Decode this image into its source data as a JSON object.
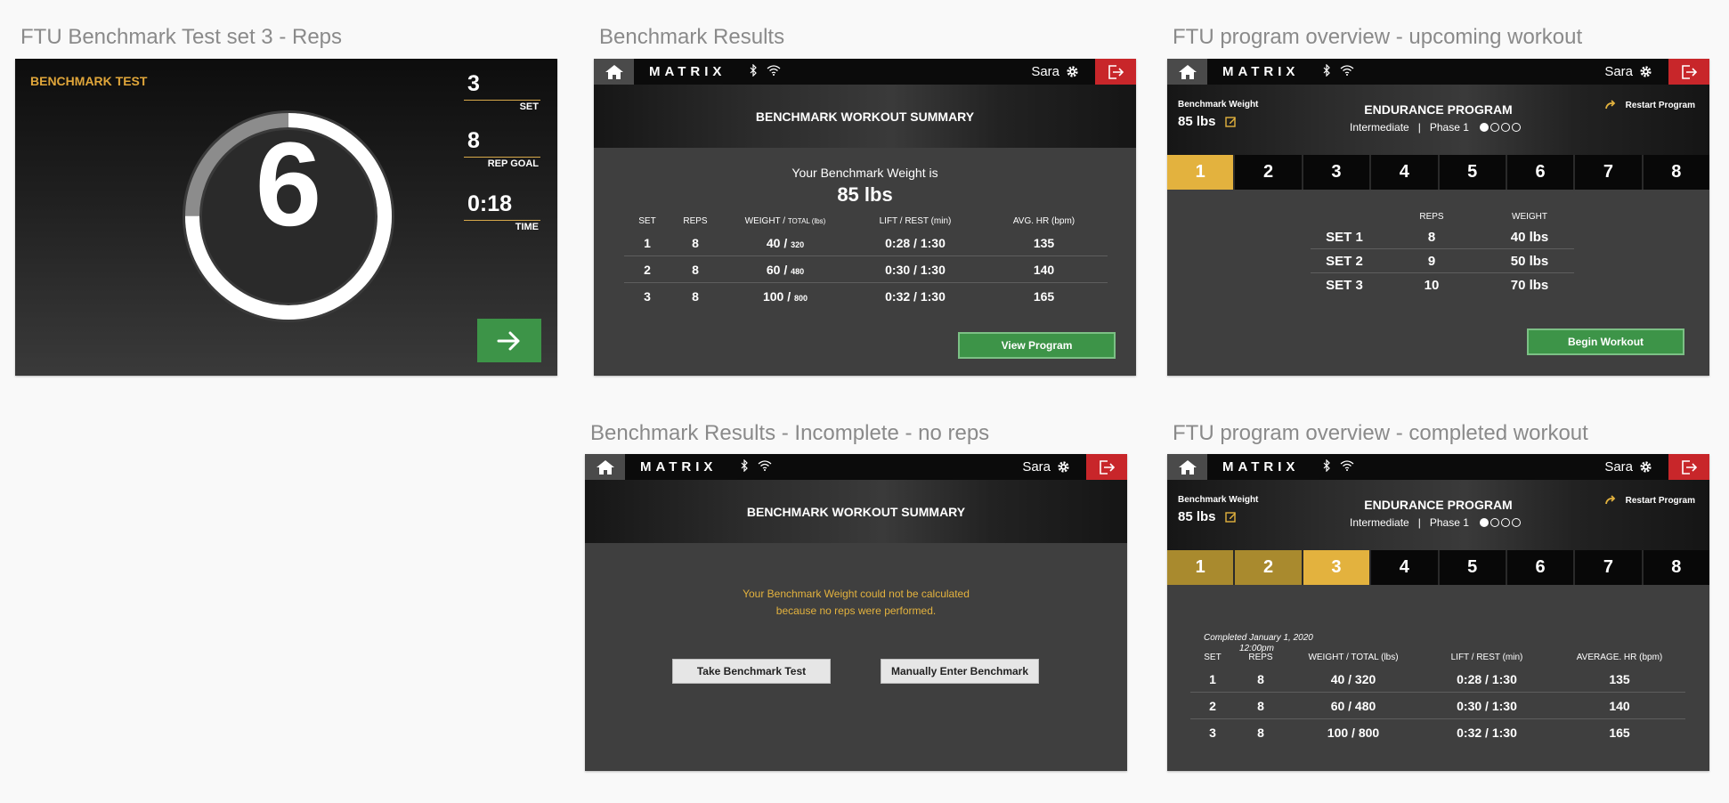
{
  "frames": {
    "rep_counter": "FTU Benchmark Test set 3 - Reps",
    "results": "Benchmark Results",
    "upcoming": "FTU program overview - upcoming workout",
    "incomplete": "Benchmark Results - Incomplete - no reps",
    "completed": "FTU program overview - completed workout"
  },
  "topbar": {
    "logo": "MATRIX",
    "user": "Sara"
  },
  "rep_counter": {
    "header": "BENCHMARK TEST",
    "count": "6",
    "set_value": "3",
    "set_label": "SET",
    "rep_goal_value": "8",
    "rep_goal_label": "REP GOAL",
    "time_value": "0:18",
    "time_label": "TIME",
    "rep_progress": 0.75
  },
  "results": {
    "title": "BENCHMARK WORKOUT SUMMARY",
    "weight_intro": "Your Benchmark Weight is",
    "weight_value": "85 lbs",
    "headers": {
      "set": "SET",
      "reps": "REPS",
      "weight": "WEIGHT / ",
      "weight_total": "TOTAL (lbs)",
      "lift": "LIFT / REST (min)",
      "hr": "AVG. HR (bpm)"
    },
    "rows": [
      {
        "set": "1",
        "reps": "8",
        "weight": "40 / ",
        "total": "320",
        "lift": "0:28 / 1:30",
        "hr": "135"
      },
      {
        "set": "2",
        "reps": "8",
        "weight": "60 / ",
        "total": "480",
        "lift": "0:30 / 1:30",
        "hr": "140"
      },
      {
        "set": "3",
        "reps": "8",
        "weight": "100 / ",
        "total": "800",
        "lift": "0:32 / 1:30",
        "hr": "165"
      }
    ],
    "view_button": "View Program"
  },
  "incomplete": {
    "title": "BENCHMARK WORKOUT SUMMARY",
    "message_line1": "Your Benchmark Weight could not be calculated",
    "message_line2": "because no reps were performed.",
    "take_button": "Take Benchmark Test",
    "manual_button": "Manually Enter Benchmark"
  },
  "program": {
    "bw_label": "Benchmark Weight",
    "bw_value": "85 lbs",
    "title": "ENDURANCE PROGRAM",
    "level": "Intermediate",
    "separator": "|",
    "phase": "Phase 1",
    "restart": "Restart Program",
    "workouts": [
      "1",
      "2",
      "3",
      "4",
      "5",
      "6",
      "7",
      "8"
    ]
  },
  "upcoming": {
    "headers": {
      "reps": "REPS",
      "weight": "WEIGHT"
    },
    "rows": [
      {
        "set": "SET 1",
        "reps": "8",
        "weight": "40 lbs"
      },
      {
        "set": "SET 2",
        "reps": "9",
        "weight": "50 lbs"
      },
      {
        "set": "SET 3",
        "reps": "10",
        "weight": "70 lbs"
      }
    ],
    "begin_button": "Begin Workout"
  },
  "completed": {
    "note": "Completed January 1, 2020",
    "time": "12:00pm",
    "headers": {
      "set": "SET",
      "reps": "REPS",
      "weight": "WEIGHT / TOTAL (lbs)",
      "lift": "LIFT / REST (min)",
      "hr": "AVERAGE. HR (bpm)"
    },
    "rows": [
      {
        "set": "1",
        "reps": "8",
        "weight": "40 / 320",
        "lift": "0:28 / 1:30",
        "hr": "135"
      },
      {
        "set": "2",
        "reps": "8",
        "weight": "60 / 480",
        "lift": "0:30 / 1:30",
        "hr": "140"
      },
      {
        "set": "3",
        "reps": "8",
        "weight": "100 / 800",
        "lift": "0:32 / 1:30",
        "hr": "165"
      }
    ]
  },
  "colors": {
    "accent": "#e3b23e",
    "action_green": "#3d9448",
    "logout_red": "#c8262a"
  }
}
